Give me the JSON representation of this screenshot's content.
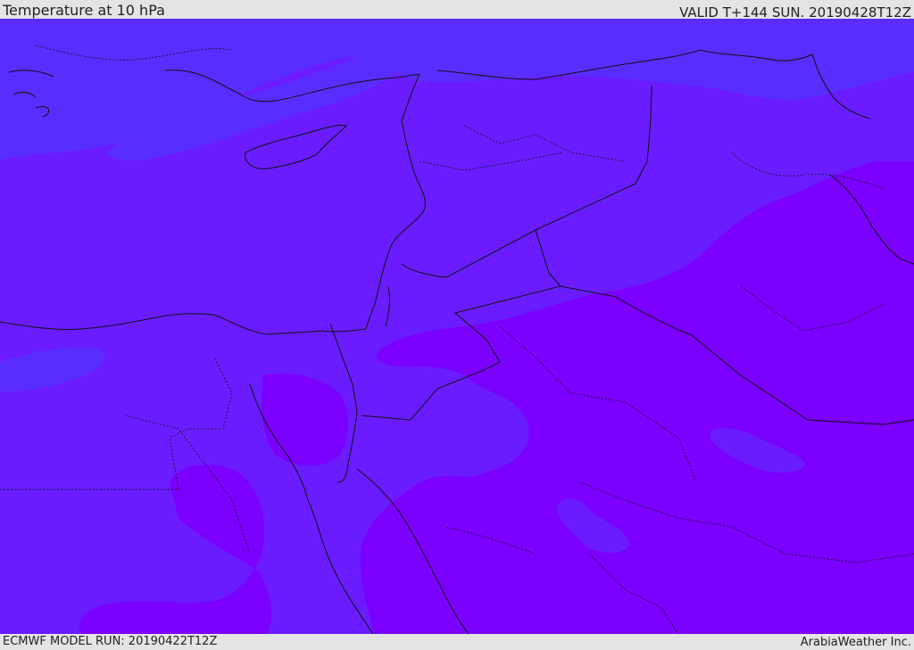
{
  "header": {
    "title": "Temperature at 10 hPa",
    "valid": "VALID T+144 SUN. 20190428T12Z"
  },
  "footer": {
    "run": "ECMWF MODEL RUN: 20190422T12Z",
    "credit": "ArabiaWeather Inc."
  },
  "colors": {
    "field_cool": "#5a2dff",
    "field_mid": "#6a1cff",
    "field_warm": "#7b00ff",
    "border_line": "#111111"
  }
}
